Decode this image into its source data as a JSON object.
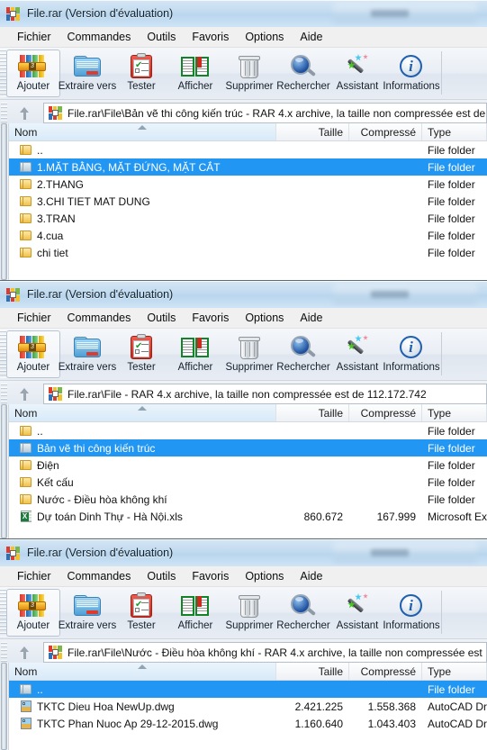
{
  "app": {
    "title": "File.rar (Version d'évaluation)",
    "rar_icon": "winrar-icon"
  },
  "menubar": {
    "items": [
      {
        "label": "Fichier",
        "name": "menu-fichier"
      },
      {
        "label": "Commandes",
        "name": "menu-commandes"
      },
      {
        "label": "Outils",
        "name": "menu-outils"
      },
      {
        "label": "Favoris",
        "name": "menu-favoris"
      },
      {
        "label": "Options",
        "name": "menu-options"
      },
      {
        "label": "Aide",
        "name": "menu-aide"
      }
    ]
  },
  "toolbar": {
    "buttons": [
      {
        "label": "Ajouter",
        "icon": "add-archive-icon",
        "selected": true
      },
      {
        "label": "Extraire vers",
        "icon": "extract-folder-icon",
        "selected": false
      },
      {
        "label": "Tester",
        "icon": "test-clipboard-icon",
        "selected": false
      },
      {
        "label": "Afficher",
        "icon": "view-book-icon",
        "selected": false
      },
      {
        "label": "Supprimer",
        "icon": "delete-trash-icon",
        "selected": false
      },
      {
        "label": "Rechercher",
        "icon": "search-magnifier-icon",
        "selected": false
      },
      {
        "label": "Assistant",
        "icon": "wizard-wand-icon",
        "selected": false
      },
      {
        "label": "Informations",
        "icon": "info-circle-icon",
        "selected": false
      }
    ]
  },
  "columns": {
    "name": "Nom",
    "size": "Taille",
    "compressed": "Compressé",
    "type": "Type"
  },
  "colors": {
    "selection": "#2196f3",
    "titlebar": "#c4dcf0",
    "header": "#d8eaf8"
  },
  "windows": [
    {
      "id": "window-1",
      "title": "File.rar (Version d'évaluation)",
      "address": "File.rar\\File\\Bản vẽ thi công kiến trúc - RAR 4.x archive, la taille non compressée est de",
      "up_button": "up-one-level-button",
      "rows": [
        {
          "name": "..",
          "icon": "folder-yellow-icon",
          "size": "",
          "compressed": "",
          "type": "File folder",
          "selected": false
        },
        {
          "name": "1.MẶT BẰNG, MẶT ĐỨNG, MẶT CẮT",
          "icon": "folder-grey-icon",
          "size": "",
          "compressed": "",
          "type": "File folder",
          "selected": true
        },
        {
          "name": "2.THANG",
          "icon": "folder-yellow-icon",
          "size": "",
          "compressed": "",
          "type": "File folder",
          "selected": false
        },
        {
          "name": "3.CHI TIET MAT DUNG",
          "icon": "folder-yellow-icon",
          "size": "",
          "compressed": "",
          "type": "File folder",
          "selected": false
        },
        {
          "name": "3.TRAN",
          "icon": "folder-yellow-icon",
          "size": "",
          "compressed": "",
          "type": "File folder",
          "selected": false
        },
        {
          "name": "4.cua",
          "icon": "folder-yellow-icon",
          "size": "",
          "compressed": "",
          "type": "File folder",
          "selected": false
        },
        {
          "name": "chi tiet",
          "icon": "folder-yellow-icon",
          "size": "",
          "compressed": "",
          "type": "File folder",
          "selected": false
        }
      ]
    },
    {
      "id": "window-2",
      "title": "File.rar (Version d'évaluation)",
      "address": "File.rar\\File - RAR 4.x archive, la taille non compressée est de 112.172.742",
      "up_button": "up-one-level-button",
      "rows": [
        {
          "name": "..",
          "icon": "folder-yellow-icon",
          "size": "",
          "compressed": "",
          "type": "File folder",
          "selected": false
        },
        {
          "name": "Bản vẽ thi công kiến trúc",
          "icon": "folder-grey-icon",
          "size": "",
          "compressed": "",
          "type": "File folder",
          "selected": true
        },
        {
          "name": "Điện",
          "icon": "folder-yellow-icon",
          "size": "",
          "compressed": "",
          "type": "File folder",
          "selected": false
        },
        {
          "name": "Kết cấu",
          "icon": "folder-yellow-icon",
          "size": "",
          "compressed": "",
          "type": "File folder",
          "selected": false
        },
        {
          "name": "Nước - Điều hòa không khí",
          "icon": "folder-yellow-icon",
          "size": "",
          "compressed": "",
          "type": "File folder",
          "selected": false
        },
        {
          "name": "Dự toán Dinh Thự - Hà Nội.xls",
          "icon": "excel-file-icon",
          "size": "860.672",
          "compressed": "167.999",
          "type": "Microsoft Excel",
          "selected": false
        }
      ]
    },
    {
      "id": "window-3",
      "title": "File.rar (Version d'évaluation)",
      "address": "File.rar\\File\\Nước - Điều hòa không khí - RAR 4.x archive, la taille non compressée est",
      "up_button": "up-one-level-button",
      "rows": [
        {
          "name": "..",
          "icon": "folder-grey-icon",
          "size": "",
          "compressed": "",
          "type": "File folder",
          "selected": true
        },
        {
          "name": "TKTC Dieu Hoa NewUp.dwg",
          "icon": "dwg-file-icon",
          "size": "2.421.225",
          "compressed": "1.558.368",
          "type": "AutoCAD Draw",
          "selected": false
        },
        {
          "name": "TKTC Phan Nuoc Ap 29-12-2015.dwg",
          "icon": "dwg-file-icon",
          "size": "1.160.640",
          "compressed": "1.043.403",
          "type": "AutoCAD Draw",
          "selected": false
        }
      ]
    }
  ]
}
